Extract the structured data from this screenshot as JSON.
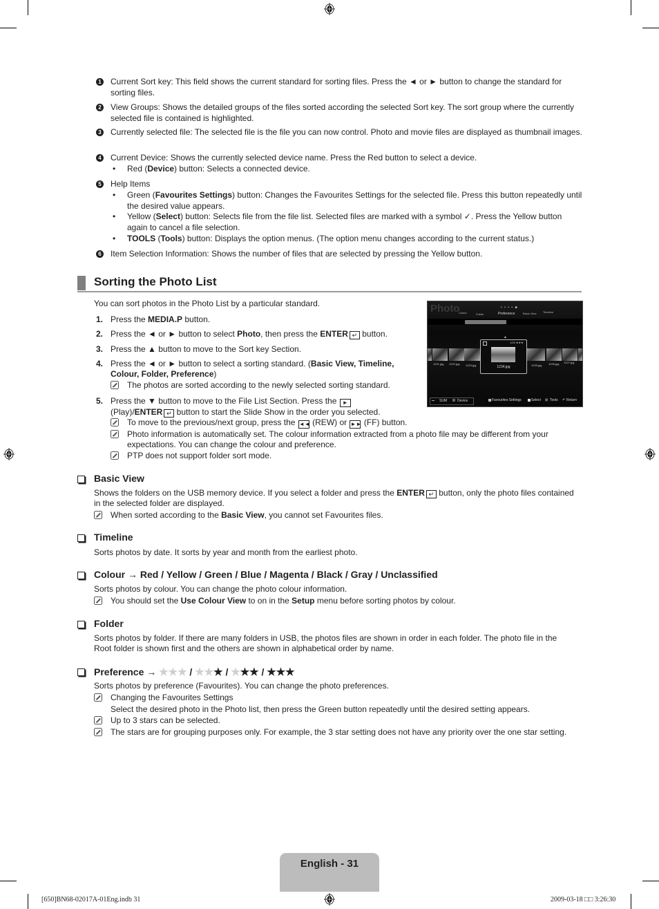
{
  "intro_items": [
    {
      "num": "1",
      "text": "Current Sort key: This field shows the current standard for sorting files. Press the ◄ or ► button to change the standard for sorting files."
    },
    {
      "num": "2",
      "text": "View Groups: Shows the detailed groups of the files sorted according the selected Sort key. The sort group where the currently selected file is contained is highlighted."
    },
    {
      "num": "3",
      "text": "Currently selected file: The selected file is the file you can now control. Photo and movie files are displayed as thumbnail images."
    },
    {
      "num": "4",
      "text": "Current Device: Shows the currently selected device name. Press the Red button to select a device."
    },
    {
      "num": "5",
      "text": "Help Items"
    },
    {
      "num": "6",
      "text": "Item Selection Information: Shows the number of files that are selected by pressing the Yellow button."
    }
  ],
  "item4_bullet": {
    "pre": "Red (",
    "bold": "Device",
    "post": ") button: Selects a connected device."
  },
  "item5_bullets": [
    {
      "pre": "Green (",
      "bold": "Favourites Settings",
      "post": ") button: Changes the Favourites Settings for the selected file. Press this button repeatedly until the desired value appears."
    },
    {
      "pre": "Yellow (",
      "bold": "Select",
      "post1": ") button: Selects file from the file list. Selected files are marked with a symbol ",
      "symbol": "✓",
      "post2": ". Press the Yellow button again to cancel a file selection."
    },
    {
      "bold1": "TOOLS",
      "mid": " (",
      "bold2": "Tools",
      "post": ") button: Displays the option menus. (The option menu changes according to the current status.)"
    }
  ],
  "section": {
    "title": "Sorting the Photo List",
    "intro": "You can sort photos in the Photo List by a particular standard.",
    "steps": [
      {
        "num": "1.",
        "pre": "Press the ",
        "bold": "MEDIA.P",
        "post": " button."
      },
      {
        "num": "2.",
        "pre": "Press the ◄ or ► button to select ",
        "bold": "Photo",
        "mid": ", then press the ",
        "bold2": "ENTER",
        "post": " button."
      },
      {
        "num": "3.",
        "text": "Press the ▲ button to move to the Sort key Section."
      },
      {
        "num": "4.",
        "pre": "Press the ◄ or ► button to select a sorting standard. (",
        "bold": "Basic View, Timeline, Colour, Folder, Preference",
        "post": ")",
        "note": "The photos are sorted according to the newly selected sorting standard."
      },
      {
        "num": "5.",
        "pre": "Press the ▼ button to move to the File List Section. Press the ",
        "mid": " (Play)/",
        "bold": "ENTER",
        "post": " button to start the Slide Show in the order you selected."
      }
    ],
    "step5_notes": [
      {
        "pre": "To move to the previous/next group, press the ",
        "mid": " (REW) or ",
        "post": " (FF) button."
      },
      {
        "text": "Photo information is automatically set. The colour information extracted from a photo file may be different from your expectations. You can change the colour and preference."
      },
      {
        "text": "PTP does not support folder sort mode."
      }
    ]
  },
  "tv_screen": {
    "title": "Photo",
    "sort_keys": [
      "Colour",
      "Folder",
      "Preference",
      "Basic View",
      "Timeline"
    ],
    "selected_file": "1234.jpg",
    "selection_info": "1/15",
    "files": [
      "1221.jpg",
      "1222.jpg",
      "1223.jpg",
      "1225.jpg",
      "1226.jpg",
      "1227.jpg"
    ],
    "device": "SUM",
    "device_label": "Device",
    "help": [
      "Favourites Settings",
      "Select",
      "Tools",
      "Return"
    ]
  },
  "subsections": {
    "basic_view": {
      "title": "Basic View",
      "pre": "Shows the folders on the USB memory device. If you select a folder and press the ",
      "bold": "ENTER",
      "post": " button, only the photo files contained in the selected folder are displayed.",
      "note_pre": "When sorted according to the ",
      "note_bold": "Basic View",
      "note_post": ", you cannot set Favourites files."
    },
    "timeline": {
      "title": "Timeline",
      "text": "Sorts photos by date. It sorts by year and month from the earliest photo."
    },
    "colour": {
      "title": "Colour → Red / Yellow / Green / Blue / Magenta / Black / Gray / Unclassified",
      "text": "Sorts photos by colour. You can change the photo colour information.",
      "note_pre": "You should set the ",
      "note_bold": "Use Colour View",
      "note_mid": " to on in the ",
      "note_bold2": "Setup",
      "note_post": " menu before sorting photos by colour."
    },
    "folder": {
      "title": "Folder",
      "text": "Sorts photos by folder. If there are many folders in USB, the photos files are shown in order in each folder. The photo file in the Root folder is shown first and the others are shown in alphabetical order by name."
    },
    "preference": {
      "title": "Preference →",
      "star_levels": [
        0,
        1,
        2,
        3
      ],
      "text": "Sorts photos by preference (Favourites). You can change the photo preferences.",
      "notes": [
        "Changing the Favourites Settings",
        "Up to 3 stars can be selected.",
        "The stars are for grouping purposes only. For example, the 3 star setting does not have any priority over the one star setting."
      ],
      "note1_detail": "Select the desired photo in the Photo list, then press the Green button repeatedly until the desired setting appears."
    }
  },
  "footer": {
    "page_label": "English - 31",
    "slug_left": "[650]BN68-02017A-01Eng.indb   31",
    "slug_right": "2009-03-18   □□ 3:26:30"
  }
}
